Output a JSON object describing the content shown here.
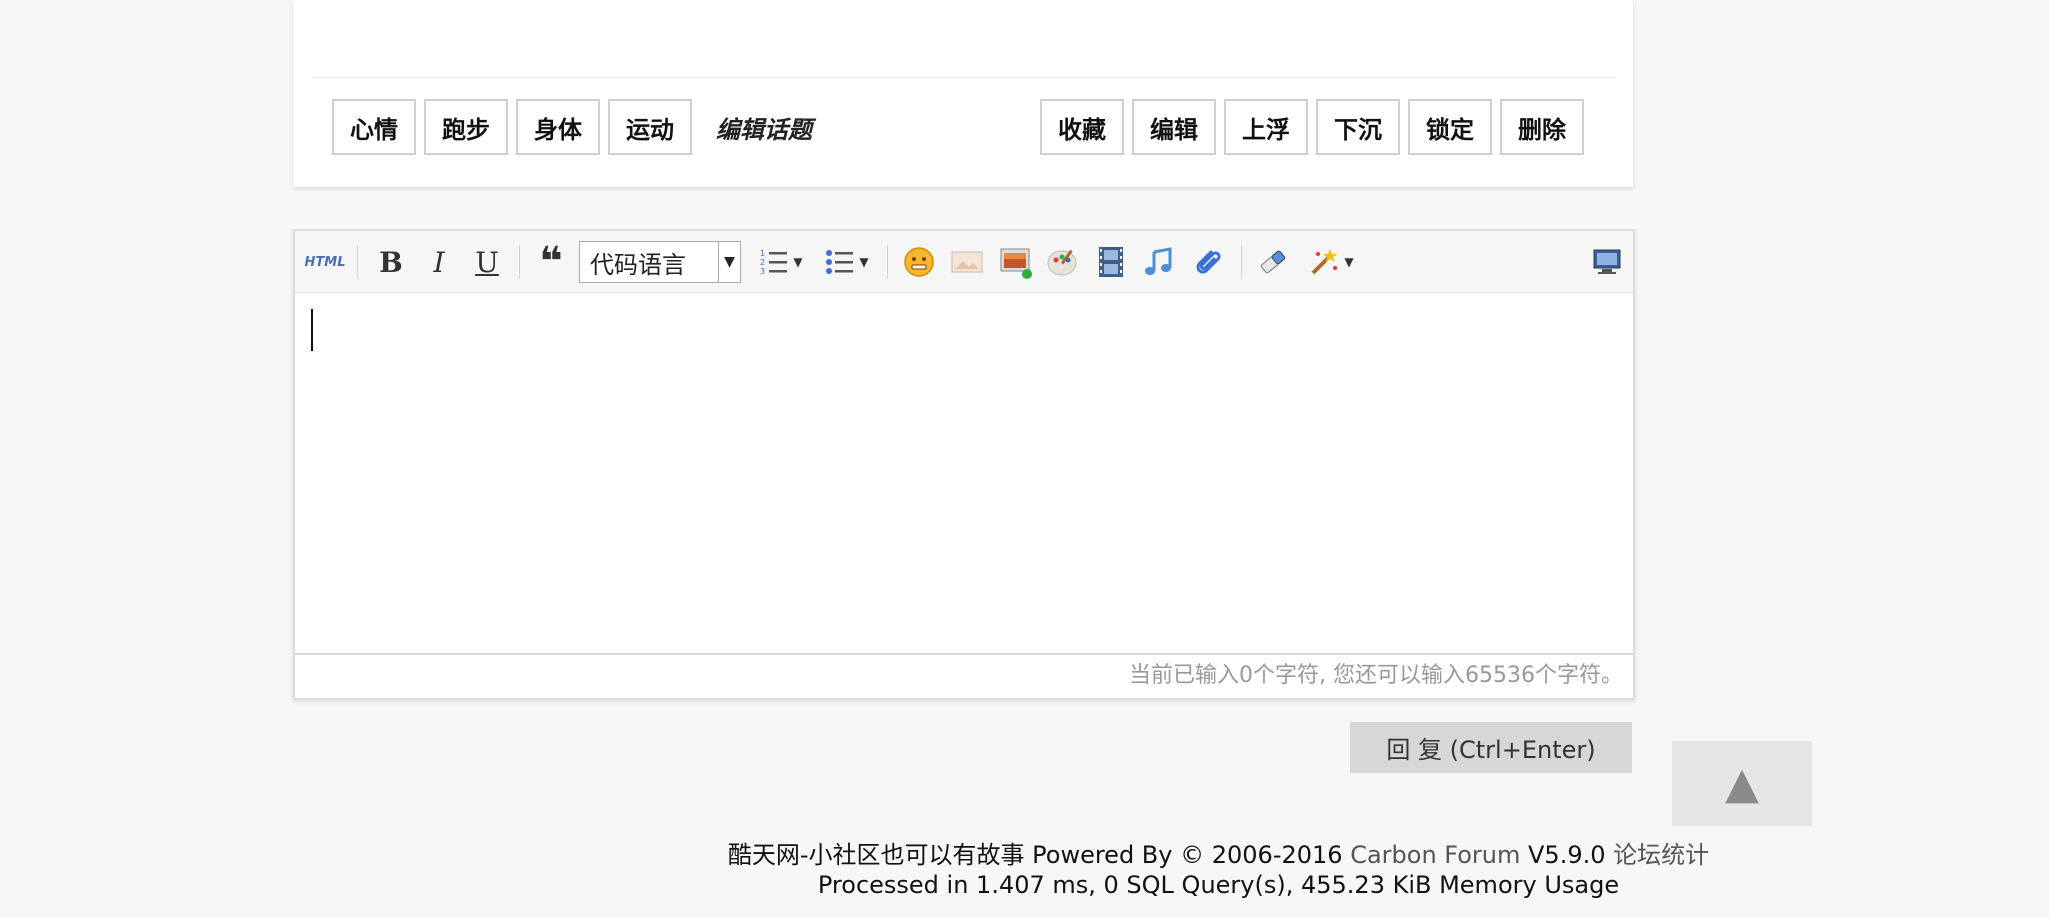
{
  "topic": {
    "tags": [
      "心情",
      "跑步",
      "身体",
      "运动"
    ],
    "edit_topics_label": "编辑话题",
    "actions": [
      "收藏",
      "编辑",
      "上浮",
      "下沉",
      "锁定",
      "删除"
    ]
  },
  "editor": {
    "toolbar": {
      "html_label": "HTML",
      "bold_label": "B",
      "italic_label": "I",
      "underline_label": "U",
      "quote_label": "❝",
      "code_language": "代码语言"
    },
    "status_text": "当前已输入0个字符, 您还可以输入65536个字符。"
  },
  "reply_button_label": "回 复 (Ctrl+Enter)",
  "scroll_top_label": "▲",
  "footer": {
    "line1_prefix": "酷天网-小社区也可以有故事 Powered By © 2006-2016 ",
    "line1_link": "Carbon Forum",
    "line1_version": " V5.9.0 ",
    "line1_stats": "论坛统计",
    "line2": "Processed in 1.407 ms, 0 SQL Query(s), 455.23 KiB Memory Usage"
  },
  "colors": {
    "background": "#f7f7f7",
    "card": "#ffffff",
    "reply_button": "#d7d7d7",
    "status_text": "#999999"
  }
}
